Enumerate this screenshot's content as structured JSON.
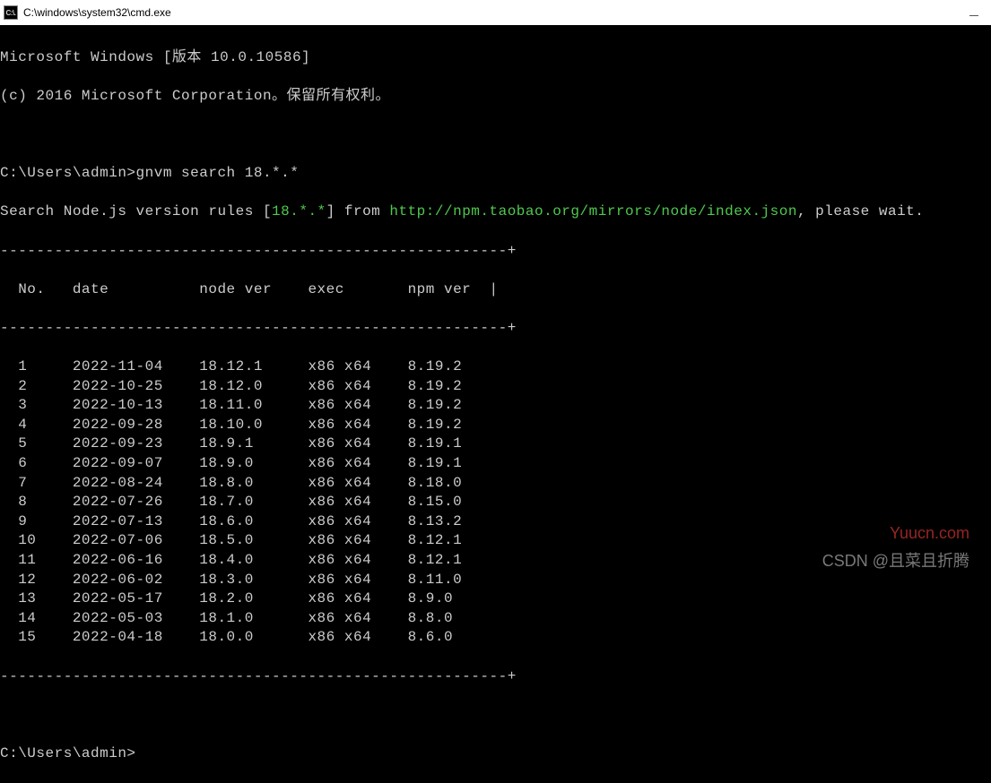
{
  "titlebar": {
    "icon_label": "C:\\.",
    "title": "C:\\windows\\system32\\cmd.exe"
  },
  "header": {
    "line1": "Microsoft Windows [版本 10.0.10586]",
    "line2": "(c) 2016 Microsoft Corporation。保留所有权利。"
  },
  "prompt1": {
    "path": "C:\\Users\\admin>",
    "command": "gnvm search 18.*.*"
  },
  "search_line": {
    "prefix": "Search Node.js version rules [",
    "pattern": "18.*.*",
    "mid": "] from ",
    "url": "http://npm.taobao.org/mirrors/node/index.json",
    "suffix": ", please wait."
  },
  "divider": "--------------------------------------------------------+",
  "table": {
    "headers": {
      "no": "No.",
      "date": "date",
      "node": "node ver",
      "exec": "exec",
      "npm": "npm ver",
      "end": "|"
    },
    "rows": [
      {
        "no": "1",
        "date": "2022-11-04",
        "node": "18.12.1",
        "exec": "x86 x64",
        "npm": "8.19.2"
      },
      {
        "no": "2",
        "date": "2022-10-25",
        "node": "18.12.0",
        "exec": "x86 x64",
        "npm": "8.19.2"
      },
      {
        "no": "3",
        "date": "2022-10-13",
        "node": "18.11.0",
        "exec": "x86 x64",
        "npm": "8.19.2"
      },
      {
        "no": "4",
        "date": "2022-09-28",
        "node": "18.10.0",
        "exec": "x86 x64",
        "npm": "8.19.2"
      },
      {
        "no": "5",
        "date": "2022-09-23",
        "node": "18.9.1",
        "exec": "x86 x64",
        "npm": "8.19.1"
      },
      {
        "no": "6",
        "date": "2022-09-07",
        "node": "18.9.0",
        "exec": "x86 x64",
        "npm": "8.19.1"
      },
      {
        "no": "7",
        "date": "2022-08-24",
        "node": "18.8.0",
        "exec": "x86 x64",
        "npm": "8.18.0"
      },
      {
        "no": "8",
        "date": "2022-07-26",
        "node": "18.7.0",
        "exec": "x86 x64",
        "npm": "8.15.0"
      },
      {
        "no": "9",
        "date": "2022-07-13",
        "node": "18.6.0",
        "exec": "x86 x64",
        "npm": "8.13.2"
      },
      {
        "no": "10",
        "date": "2022-07-06",
        "node": "18.5.0",
        "exec": "x86 x64",
        "npm": "8.12.1"
      },
      {
        "no": "11",
        "date": "2022-06-16",
        "node": "18.4.0",
        "exec": "x86 x64",
        "npm": "8.12.1"
      },
      {
        "no": "12",
        "date": "2022-06-02",
        "node": "18.3.0",
        "exec": "x86 x64",
        "npm": "8.11.0"
      },
      {
        "no": "13",
        "date": "2022-05-17",
        "node": "18.2.0",
        "exec": "x86 x64",
        "npm": "8.9.0"
      },
      {
        "no": "14",
        "date": "2022-05-03",
        "node": "18.1.0",
        "exec": "x86 x64",
        "npm": "8.8.0"
      },
      {
        "no": "15",
        "date": "2022-04-18",
        "node": "18.0.0",
        "exec": "x86 x64",
        "npm": "8.6.0"
      }
    ]
  },
  "prompt2": {
    "path": "C:\\Users\\admin>"
  },
  "watermarks": {
    "w1": "Yuucn.com",
    "w2": "CSDN @且菜且折腾"
  }
}
